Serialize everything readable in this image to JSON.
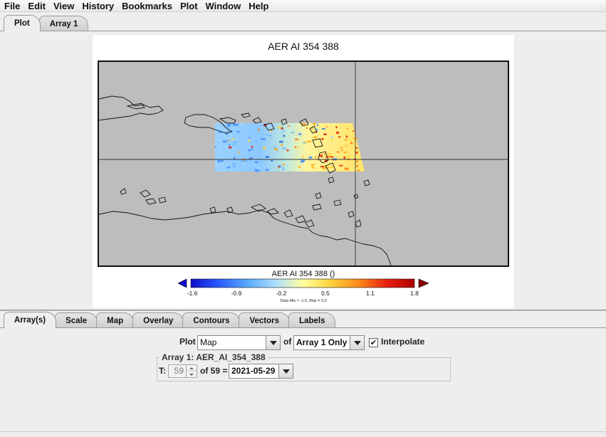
{
  "menu": [
    "File",
    "Edit",
    "View",
    "History",
    "Bookmarks",
    "Plot",
    "Window",
    "Help"
  ],
  "top_tabs": [
    {
      "label": "Plot",
      "active": true
    },
    {
      "label": "Array 1",
      "active": false
    }
  ],
  "plot": {
    "title": "AER AI 354 388",
    "colorbar": {
      "title": "AER AI 354 388 ()",
      "ticks": [
        "-1.6",
        "-0.9",
        "-0.2",
        "0.5",
        "1.1",
        "1.8"
      ],
      "note": "Data Min = -1.5, Max = 2.0",
      "colors": [
        "#1010c8",
        "#2a5bff",
        "#55a8ff",
        "#a8dcff",
        "#ffffa0",
        "#ffd23a",
        "#ff8a1a",
        "#e82010",
        "#b00000"
      ]
    },
    "map_background": "#bdbdbd"
  },
  "bottom_tabs": [
    {
      "label": "Array(s)",
      "active": true
    },
    {
      "label": "Scale",
      "active": false
    },
    {
      "label": "Map",
      "active": false
    },
    {
      "label": "Overlay",
      "active": false
    },
    {
      "label": "Contours",
      "active": false
    },
    {
      "label": "Vectors",
      "active": false
    },
    {
      "label": "Labels",
      "active": false
    }
  ],
  "controls": {
    "plot_label": "Plot",
    "plot_type": "Map",
    "of_label": "of",
    "array_select": "Array 1 Only",
    "interpolate_label": "Interpolate",
    "interpolate_checked": "✔",
    "group_title": "Array 1: AER_AI_354_388",
    "t_label": "T:",
    "t_value": "59",
    "of_count": "of 59 =",
    "date_value": "2021-05-29"
  }
}
